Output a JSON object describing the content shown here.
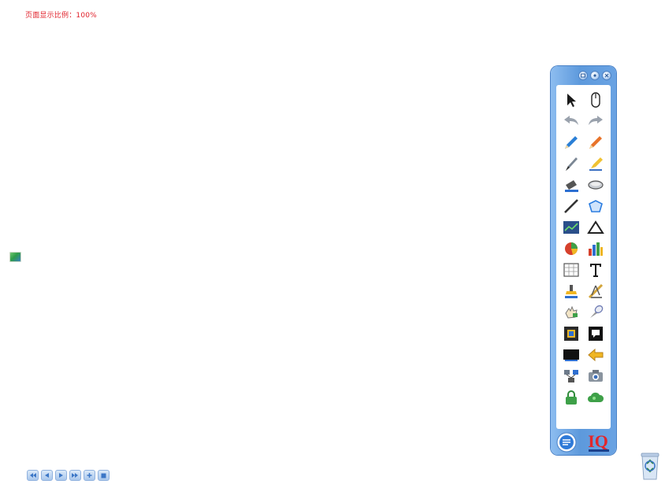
{
  "page": {
    "zoom_text": "页面显示比例：100%"
  },
  "toolbar": {
    "window_buttons": [
      "restore-icon",
      "pin-icon",
      "close-icon"
    ],
    "tools": [
      {
        "name": "select-arrow-icon"
      },
      {
        "name": "mouse-icon"
      },
      {
        "name": "undo-icon"
      },
      {
        "name": "redo-icon"
      },
      {
        "name": "pen-blue-icon"
      },
      {
        "name": "pen-orange-icon"
      },
      {
        "name": "brush-icon"
      },
      {
        "name": "highlighter-icon"
      },
      {
        "name": "bucket-eraser-icon"
      },
      {
        "name": "eraser-icon"
      },
      {
        "name": "line-icon"
      },
      {
        "name": "shape-fill-icon"
      },
      {
        "name": "line-chart-icon"
      },
      {
        "name": "triangle-icon"
      },
      {
        "name": "pie-chart-icon"
      },
      {
        "name": "bar-chart-icon"
      },
      {
        "name": "grid-icon"
      },
      {
        "name": "text-icon"
      },
      {
        "name": "stamp-icon"
      },
      {
        "name": "ruler-compass-icon"
      },
      {
        "name": "screenshot-hand-icon"
      },
      {
        "name": "spotlight-icon"
      },
      {
        "name": "magnifier-frame-icon"
      },
      {
        "name": "note-icon"
      },
      {
        "name": "screen-icon"
      },
      {
        "name": "back-arrow-icon"
      },
      {
        "name": "network-icon"
      },
      {
        "name": "camera-icon"
      },
      {
        "name": "lock-icon"
      },
      {
        "name": "cloud-icon"
      }
    ],
    "footer": [
      "menu-icon",
      "logo-icon"
    ],
    "footer_logo_text": "IQ"
  },
  "pager": [
    "page-first-icon",
    "page-prev-icon",
    "page-next-icon",
    "page-last-icon",
    "page-add-icon",
    "page-delete-icon"
  ],
  "colors": {
    "accent": "#5d99dc",
    "zoom_text": "#e0202a"
  }
}
